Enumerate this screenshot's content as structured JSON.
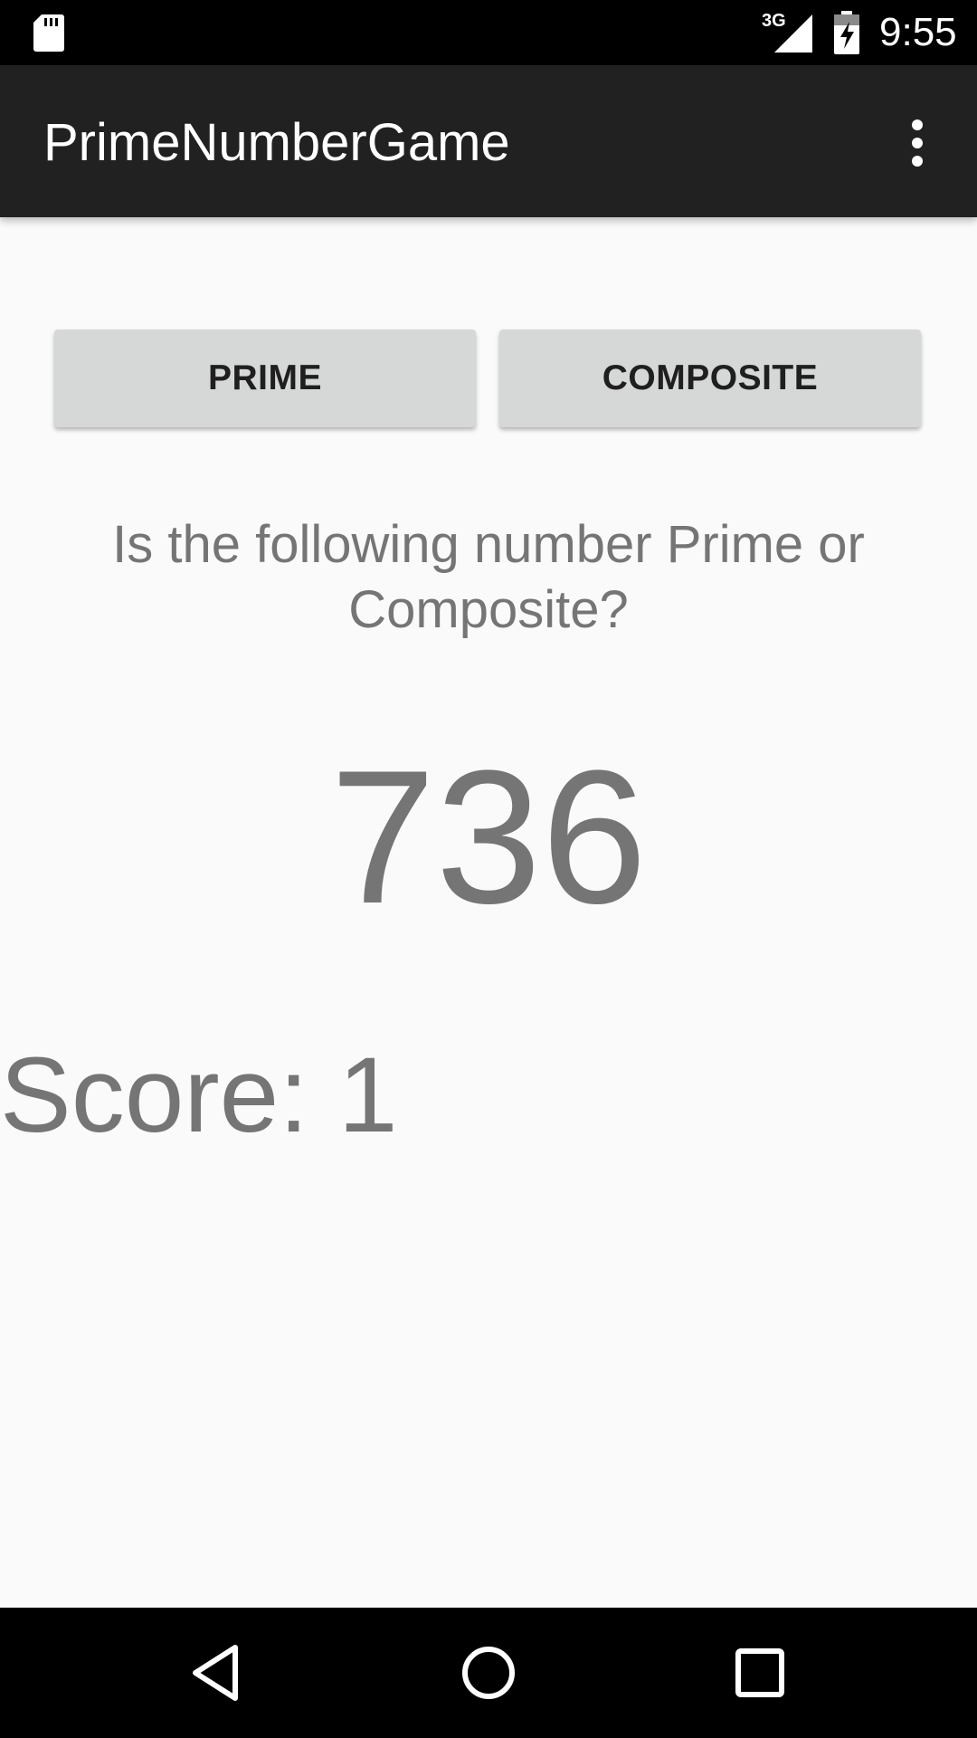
{
  "status_bar": {
    "network_type": "3G",
    "time": "9:55",
    "icons": [
      "sd-card-icon",
      "signal-icon",
      "battery-charging-icon"
    ]
  },
  "app_bar": {
    "title": "PrimeNumberGame",
    "overflow_icon": "more-vert-icon"
  },
  "buttons": {
    "prime_label": "PRIME",
    "composite_label": "COMPOSITE"
  },
  "question": "Is the following number Prime or Composite?",
  "number": "736",
  "score": "Score: 1",
  "nav_bar": {
    "icons": [
      "back-icon",
      "home-icon",
      "recents-icon"
    ]
  },
  "colors": {
    "status_bar": "#000000",
    "app_bar": "#212121",
    "background": "#fafafa",
    "button": "#d6d7d7",
    "text_secondary": "#757575"
  }
}
